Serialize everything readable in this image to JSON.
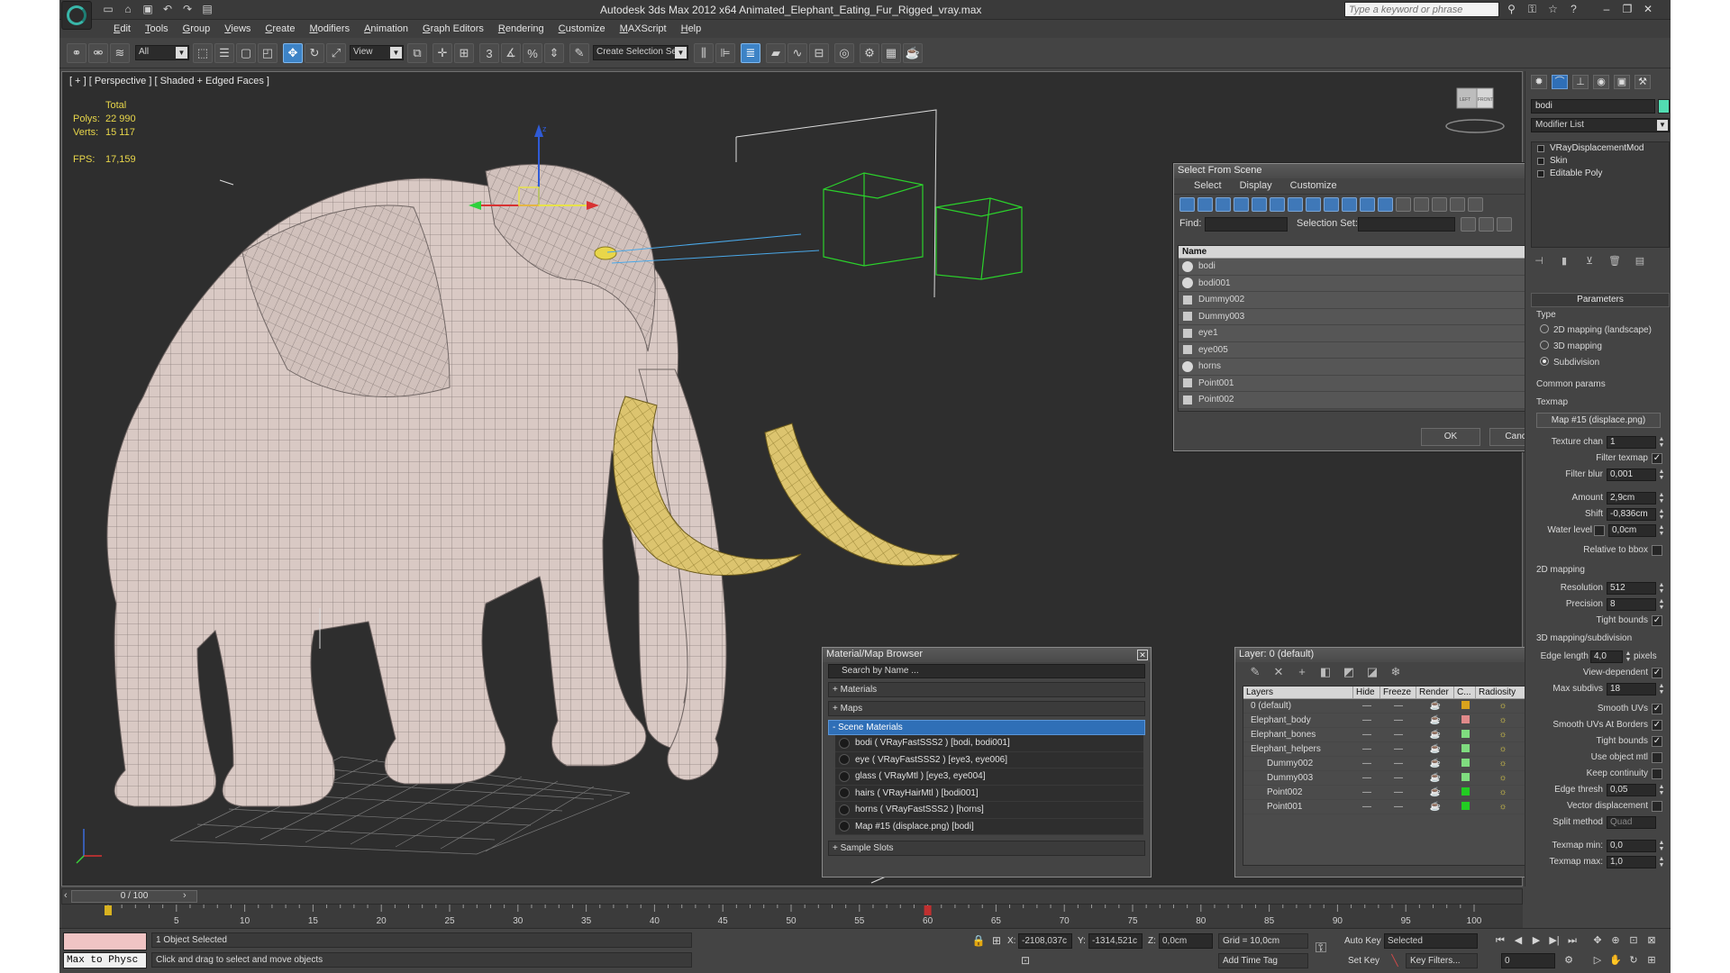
{
  "window": {
    "title": "Autodesk 3ds Max  2012 x64     Animated_Elephant_Eating_Fur_Rigged_vray.max",
    "search_placeholder": "Type a keyword or phrase"
  },
  "menu": [
    "Edit",
    "Tools",
    "Group",
    "Views",
    "Create",
    "Modifiers",
    "Animation",
    "Graph Editors",
    "Rendering",
    "Customize",
    "MAXScript",
    "Help"
  ],
  "toolbar": {
    "selection_filter": "All",
    "ref_coord": "View",
    "named_selection": "Create Selection Se",
    "snap_label": "3"
  },
  "viewport": {
    "label": "[ + ] [ Perspective ] [ Shaded + Edged Faces ]",
    "stats": {
      "header": "Total",
      "polys_label": "Polys:",
      "polys": "22 990",
      "verts_label": "Verts:",
      "verts": "15 117",
      "fps_label": "FPS:",
      "fps": "17,159"
    },
    "axis_z": "z",
    "viewcube_left": "LEFT",
    "viewcube_front": "FRONT"
  },
  "select_from_scene": {
    "title": "Select From Scene",
    "tabs": [
      "Select",
      "Display",
      "Customize"
    ],
    "find_label": "Find:",
    "selection_set_label": "Selection Set:",
    "column_name": "Name",
    "items": [
      {
        "name": "bodi",
        "kind": "geo"
      },
      {
        "name": "bodi001",
        "kind": "geo"
      },
      {
        "name": "Dummy002",
        "kind": "helper"
      },
      {
        "name": "Dummy003",
        "kind": "helper"
      },
      {
        "name": "eye1",
        "kind": "helper"
      },
      {
        "name": "eye005",
        "kind": "helper"
      },
      {
        "name": "horns",
        "kind": "geo"
      },
      {
        "name": "Point001",
        "kind": "helper"
      },
      {
        "name": "Point002",
        "kind": "helper"
      }
    ],
    "ok": "OK",
    "cancel": "Cancel"
  },
  "material_browser": {
    "title": "Material/Map Browser",
    "search": "Search by Name ...",
    "materials": "+ Materials",
    "maps": "+ Maps",
    "scene_materials": "- Scene Materials",
    "items": [
      "bodi  ( VRayFastSSS2 ) [bodi, bodi001]",
      "eye  ( VRayFastSSS2 ) [eye3, eye006]",
      "glass  ( VRayMtl ) [eye3, eye004]",
      "hairs  ( VRayHairMtl ) [bodi001]",
      "horns  ( VRayFastSSS2 ) [horns]",
      "Map #15 (displace.png) [bodi]"
    ],
    "sample_slots": "+ Sample Slots"
  },
  "layer_dialog": {
    "title": "Layer: 0 (default)",
    "columns": [
      "Layers",
      "Hide",
      "Freeze",
      "Render",
      "C...",
      "Radiosity"
    ],
    "rows": [
      {
        "name": "0 (default)",
        "color": "#d9a31d",
        "indent": 0
      },
      {
        "name": "Elephant_body",
        "color": "#e08a8a",
        "indent": 0
      },
      {
        "name": "Elephant_bones",
        "color": "#7fdc7f",
        "indent": 0
      },
      {
        "name": "Elephant_helpers",
        "color": "#7fdc7f",
        "indent": 0
      },
      {
        "name": "Dummy002",
        "color": "#7fdc7f",
        "indent": 1
      },
      {
        "name": "Dummy003",
        "color": "#7fdc7f",
        "indent": 1
      },
      {
        "name": "Point002",
        "color": "#22cc22",
        "indent": 1
      },
      {
        "name": "Point001",
        "color": "#22cc22",
        "indent": 1
      }
    ]
  },
  "command_panel": {
    "object_name": "bodi",
    "modifier_list": "Modifier List",
    "stack": [
      "VRayDisplacementMod",
      "Skin",
      "Editable Poly"
    ],
    "parameters": "Parameters",
    "type_label": "Type",
    "type_options": [
      "2D mapping (landscape)",
      "3D mapping",
      "Subdivision"
    ],
    "common_params": "Common params",
    "texmap": "Texmap",
    "texmap_button": "Map #15 (displace.png)",
    "texture_chan_label": "Texture chan",
    "texture_chan": "1",
    "filter_texmap": "Filter texmap",
    "filter_blur_label": "Filter blur",
    "filter_blur": "0,001",
    "amount_label": "Amount",
    "amount": "2,9cm",
    "shift_label": "Shift",
    "shift": "-0,836cm",
    "water_level_label": "Water level",
    "water_level": "0,0cm",
    "relative_bbox": "Relative to bbox",
    "mapping_2d": "2D mapping",
    "resolution_label": "Resolution",
    "resolution": "512",
    "precision_label": "Precision",
    "precision": "8",
    "tight_bounds": "Tight bounds",
    "mapping_3d": "3D mapping/subdivision",
    "edge_length_label": "Edge length",
    "edge_length": "4,0",
    "pixels": "pixels",
    "view_dependent": "View-dependent",
    "max_subdivs_label": "Max subdivs",
    "max_subdivs": "18",
    "smooth_uvs": "Smooth UVs",
    "smooth_uvs_borders": "Smooth UVs At Borders",
    "tight_bounds2": "Tight bounds",
    "use_object_mtl": "Use object mtl",
    "keep_continuity": "Keep continuity",
    "edge_thresh_label": "Edge thresh",
    "edge_thresh": "0,05",
    "vector_disp": "Vector displacement",
    "split_method_label": "Split method",
    "split_method": "Quad",
    "texmap_min_label": "Texmap min:",
    "texmap_min": "0,0",
    "texmap_max_label": "Texmap max:",
    "texmap_max": "1,0"
  },
  "timeline": {
    "frame": "0 / 100",
    "ticks": [
      "5",
      "10",
      "15",
      "20",
      "25",
      "30",
      "35",
      "40",
      "45",
      "50",
      "55",
      "60",
      "65",
      "70",
      "75",
      "80",
      "85",
      "90",
      "95",
      "100"
    ]
  },
  "status": {
    "maxscript": "Max to Physc",
    "selected": "1 Object Selected",
    "prompt": "Click and drag to select and move objects",
    "x_label": "X:",
    "x": "-2108,037c",
    "y_label": "Y:",
    "y": "-1314,521c",
    "z_label": "Z:",
    "z": "0,0cm",
    "grid": "Grid = 10,0cm",
    "add_time_tag": "Add Time Tag",
    "auto_key": "Auto Key",
    "set_key": "Set Key",
    "key_mode": "Selected",
    "key_filters": "Key Filters...",
    "current_frame": "0"
  }
}
